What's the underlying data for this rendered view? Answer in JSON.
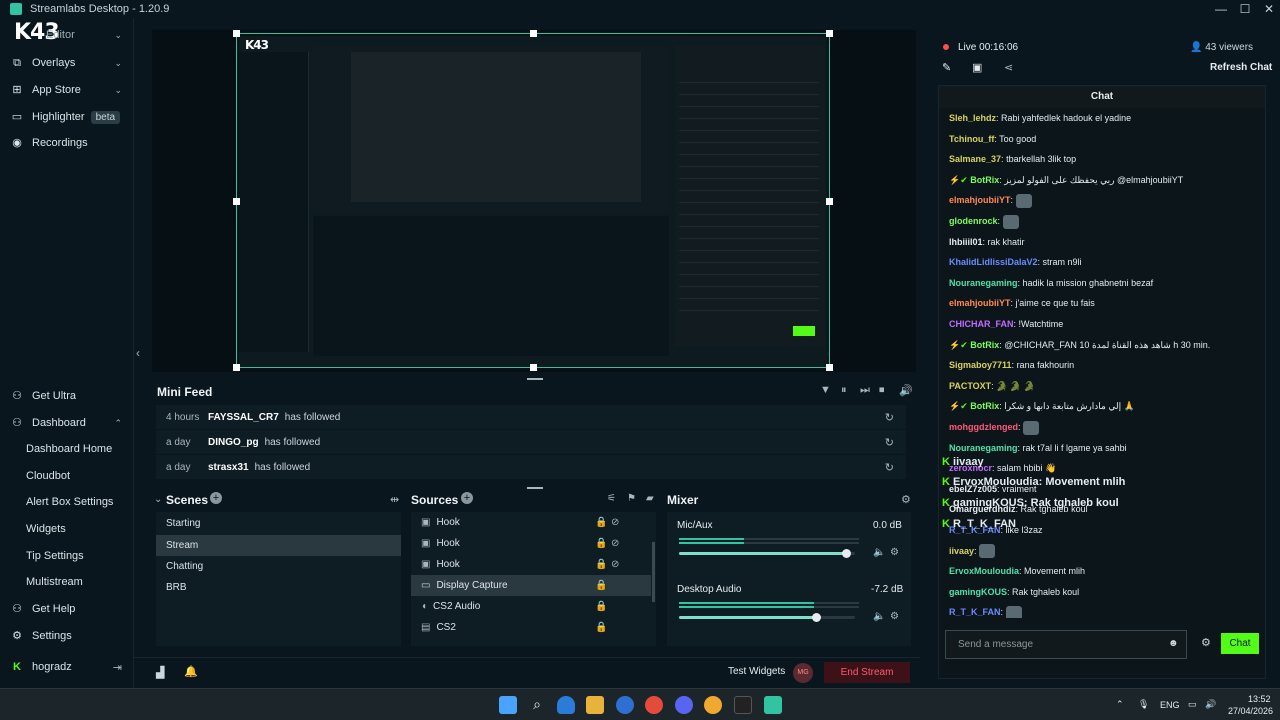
{
  "window": {
    "title": "Streamlabs Desktop - 1.20.9",
    "controls": [
      "minimize-icon",
      "maximize-icon",
      "close-icon"
    ]
  },
  "logo_text": "K43",
  "sidebar": {
    "top_items": [
      {
        "label": "Editor",
        "icon": "editor-icon",
        "chevron": true
      },
      {
        "label": "Overlays",
        "icon": "overlays-icon",
        "chevron": true
      },
      {
        "label": "App Store",
        "icon": "app-store-icon",
        "chevron": true
      },
      {
        "label": "Highlighter",
        "icon": "highlighter-icon",
        "badge": "beta"
      },
      {
        "label": "Recordings",
        "icon": "recordings-icon"
      }
    ],
    "bottom_items": {
      "get_ultra": "Get Ultra",
      "dashboard": "Dashboard",
      "dashboard_sub": [
        "Dashboard Home",
        "Cloudbot",
        "Alert Box Settings",
        "Widgets",
        "Tip Settings",
        "Multistream"
      ],
      "get_help": "Get Help",
      "settings": "Settings",
      "user": "hogradz"
    }
  },
  "mini_feed": {
    "title": "Mini Feed",
    "rows": [
      {
        "time": "4 hours",
        "user": "FAYSSAL_CR7",
        "action": "has followed"
      },
      {
        "time": "a day",
        "user": "DINGO_pg",
        "action": "has followed"
      },
      {
        "time": "a day",
        "user": "strasx31",
        "action": "has followed"
      }
    ]
  },
  "scenes": {
    "title": "Scenes",
    "items": [
      "Starting",
      "Stream",
      "Chatting",
      "BRB"
    ],
    "selected": "Stream"
  },
  "sources": {
    "title": "Sources",
    "items": [
      {
        "label": "Hook",
        "icon": "image-icon"
      },
      {
        "label": "Hook",
        "icon": "image-icon"
      },
      {
        "label": "Hook",
        "icon": "image-icon"
      },
      {
        "label": "Display Capture",
        "icon": "monitor-icon"
      },
      {
        "label": "CS2 Audio",
        "icon": "speaker-icon"
      },
      {
        "label": "CS2",
        "icon": "gamepad-icon"
      }
    ],
    "selected": "Display Capture"
  },
  "mixer": {
    "title": "Mixer",
    "channels": [
      {
        "name": "Mic/Aux",
        "db": "0.0 dB",
        "level": 0.95
      },
      {
        "name": "Desktop Audio",
        "db": "-7.2 dB",
        "level": 0.78
      }
    ]
  },
  "bottom_bar": {
    "test_widgets": "Test Widgets",
    "end_stream": "End Stream",
    "avatar_text": "MG"
  },
  "chat": {
    "live_label": "Live",
    "live_time": "00:16:06",
    "viewers": "43 viewers",
    "refresh_label": "Refresh Chat",
    "header": "Chat",
    "messages": [
      {
        "user": "Sleh_lehdz",
        "color": "#d8d35a",
        "text": "Rabi yahfedlek hadouk el yadine"
      },
      {
        "user": "Tchinou_ff",
        "color": "#d8d35a",
        "text": "Too good"
      },
      {
        "user": "Salmane_37",
        "color": "#d8d35a",
        "text": "tbarkellah 3lik top"
      },
      {
        "user": "BotRix",
        "color": "#7cff5a",
        "text": "ربي يحفظك على الفولو لمزيز @elmahjoubiiYT",
        "badges": true
      },
      {
        "user": "elmahjoubiiYT",
        "color": "#ff8a4c",
        "text": ""
      },
      {
        "user": "glodenrock",
        "color": "#7cff5a",
        "text": ""
      },
      {
        "user": "lhbiiil01",
        "color": "#e6ecef",
        "text": "rak khatir"
      },
      {
        "user": "KhalidLidlissiDalaV2",
        "color": "#6a8cff",
        "text": "stram n9li"
      },
      {
        "user": "Nouranegaming",
        "color": "#4fe3a8",
        "text": "hadik la mission ghabnetni bezaf"
      },
      {
        "user": "elmahjoubiiYT",
        "color": "#ff8a4c",
        "text": "j'aime ce que tu fais"
      },
      {
        "user": "CHICHAR_FAN",
        "color": "#c46bff",
        "text": "!Watchtime"
      },
      {
        "user": "BotRix",
        "color": "#7cff5a",
        "text": "@CHICHAR_FAN 10 شاهد هذه القناة لمدة h 30 min.",
        "badges": true
      },
      {
        "user": "Sigmaboy7711",
        "color": "#d8d35a",
        "text": "rana fakhourin"
      },
      {
        "user": "PACTOXT",
        "color": "#d8d35a",
        "text": "🐊 🐊 🐊"
      },
      {
        "user": "BotRix",
        "color": "#7cff5a",
        "text": "إلي مادارش متابعة دابها و شكرا 🙏",
        "badges": true
      },
      {
        "user": "mohggdzlenged",
        "color": "#ff5a7a",
        "text": ""
      },
      {
        "user": "Nouranegaming",
        "color": "#4fe3a8",
        "text": "rak t7al li f lgame ya sahbi"
      },
      {
        "user": "zeroxnocr",
        "color": "#c46bff",
        "text": "salam hbibi 👋"
      },
      {
        "user": "ebeIZ7z005",
        "color": "#e6ecef",
        "text": "vraiment"
      },
      {
        "user": "Omarguerdhdiz",
        "color": "#e6ecef",
        "text": "Rak tghaleb koul"
      },
      {
        "user": "R_T_K_FAN",
        "color": "#6a8cff",
        "text": "like l3zaz"
      },
      {
        "user": "iivaay",
        "color": "#d8d35a",
        "text": ""
      },
      {
        "user": "ErvoxMouloudia",
        "color": "#4fe3a8",
        "text": "Movement mlih"
      },
      {
        "user": "gamingKOUS",
        "color": "#4fe3a8",
        "text": "Rak tghaleb koul"
      },
      {
        "user": "R_T_K_FAN",
        "color": "#6a8cff",
        "text": ""
      }
    ],
    "overlay_lines": [
      {
        "user": "iivaay",
        "text": ""
      },
      {
        "user": "ErvoxMouloudia",
        "text": "Movement mlih"
      },
      {
        "user": "gamingKOUS",
        "text": "Rak tghaleb koul"
      },
      {
        "user": "R_T_K_FAN",
        "text": ""
      }
    ],
    "input_placeholder": "Send a message",
    "send_label": "Chat"
  },
  "taskbar": {
    "lang": "ENG",
    "time": "13:52",
    "date": "27/04/2026"
  },
  "colors": {
    "accent": "#31c3a2",
    "chat_button": "#53fc18",
    "bg": "#09161d",
    "end_stream_bg": "#3c1218",
    "end_stream_text": "#ff5a6b"
  }
}
